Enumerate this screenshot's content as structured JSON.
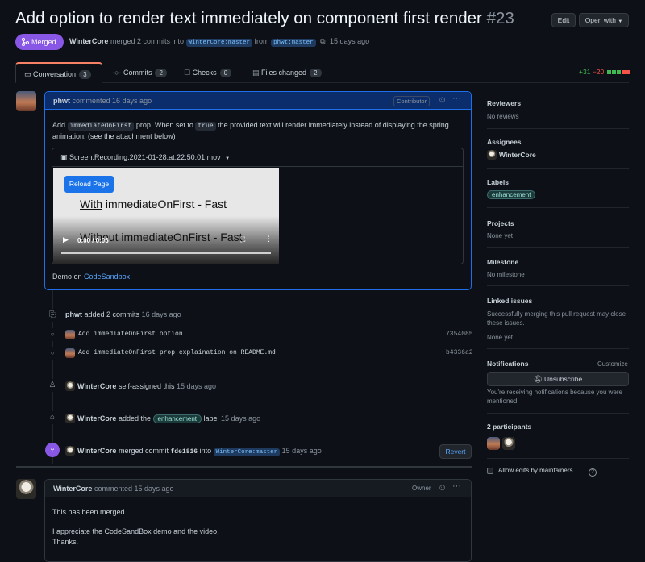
{
  "header": {
    "title": "Add option to render text immediately on component first render",
    "number": "#23",
    "edit_label": "Edit",
    "open_with_label": "Open with",
    "state_label": "Merged",
    "author": "WinterCore",
    "merge_text": "merged 2 commits into",
    "base_branch": "WinterCore:master",
    "from_text": "from",
    "head_branch": "phwt:master",
    "time": "15 days ago"
  },
  "tabs": [
    {
      "label": "Conversation",
      "count": "3"
    },
    {
      "label": "Commits",
      "count": "2"
    },
    {
      "label": "Checks",
      "count": "0"
    },
    {
      "label": "Files changed",
      "count": "2"
    }
  ],
  "diffstat": {
    "additions": "+31",
    "deletions": "−20"
  },
  "colors": {
    "accent": "#58a6ff",
    "merged": "#8957e5",
    "add": "#3fb950",
    "del": "#f85149"
  },
  "comment1": {
    "author": "phwt",
    "action": "commented 16 days ago",
    "badge": "Contributor",
    "body_pre": "Add",
    "code1": "immediateOnFirst",
    "body_mid": "prop. When set to",
    "code2": "true",
    "body_post": "the provided text will render immediately instead of displaying the spring animation. (see the attachment below)",
    "attachment_name": "Screen.Recording.2021-01-28.at.22.50.01.mov",
    "video_button": "Reload Page",
    "video_line1_u": "With",
    "video_line1": "immediateOnFirst - Fast",
    "video_line2": "Without immediateOnFirst - Fast",
    "video_time": "0:00 / 0:06",
    "demo_pre": "Demo on",
    "demo_link": "CodeSandbox"
  },
  "timeline": {
    "commits_author": "phwt",
    "commits_action": "added 2 commits",
    "commits_time": "16 days ago",
    "commits": [
      {
        "message": "Add immediateOnFirst option",
        "sha": "7354085"
      },
      {
        "message": "Add immediateOnFirst prop explaination on README.md",
        "sha": "b4336a2"
      }
    ],
    "assign_author": "WinterCore",
    "assign_action": "self-assigned this",
    "assign_time": "15 days ago",
    "label_author": "WinterCore",
    "label_pre": "added the",
    "label_name": "enhancement",
    "label_post": "label",
    "label_time": "15 days ago",
    "merge_author": "WinterCore",
    "merge_pre": "merged commit",
    "merge_sha": "fde1816",
    "merge_into": "into",
    "merge_branch": "WinterCore:master",
    "merge_time": "15 days ago",
    "revert_label": "Revert"
  },
  "comment2": {
    "author": "WinterCore",
    "action": "commented 15 days ago",
    "badge": "Owner",
    "line1": "This has been merged.",
    "line2": "I appreciate the CodeSandBox demo and the video.",
    "line3": "Thanks."
  },
  "sidebar": {
    "reviewers_h": "Reviewers",
    "reviewers_v": "No reviews",
    "assignees_h": "Assignees",
    "assignees_v": "WinterCore",
    "labels_h": "Labels",
    "labels_v": "enhancement",
    "projects_h": "Projects",
    "projects_v": "None yet",
    "milestone_h": "Milestone",
    "milestone_v": "No milestone",
    "linked_h": "Linked issues",
    "linked_desc": "Successfully merging this pull request may close these issues.",
    "linked_v": "None yet",
    "notif_h": "Notifications",
    "notif_customize": "Customize",
    "unsubscribe": "Unsubscribe",
    "notif_desc": "You're receiving notifications because you were mentioned.",
    "participants_h": "2 participants",
    "allow_edits": "Allow edits by maintainers"
  }
}
